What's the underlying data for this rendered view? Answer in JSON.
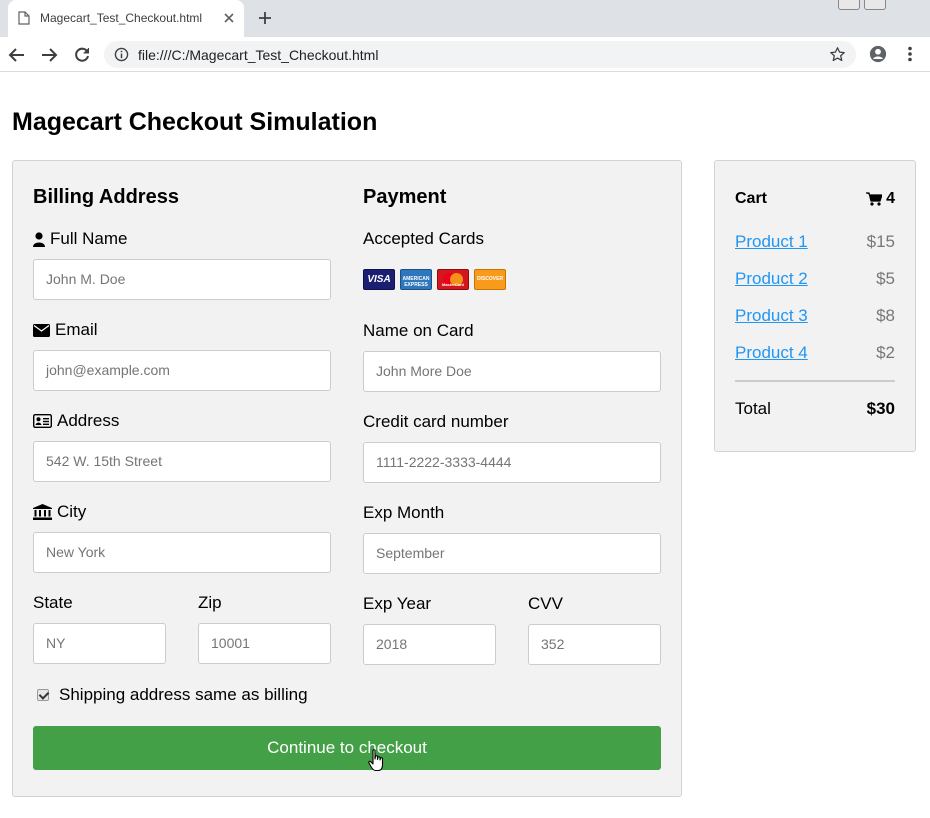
{
  "browser": {
    "tab_title": "Magecart_Test_Checkout.html",
    "url": "file:///C:/Magecart_Test_Checkout.html"
  },
  "page": {
    "title": "Magecart Checkout Simulation"
  },
  "billing": {
    "heading": "Billing Address",
    "full_name": {
      "label": "Full Name",
      "placeholder": "John M. Doe",
      "icon": "user-icon"
    },
    "email": {
      "label": "Email",
      "placeholder": "john@example.com",
      "icon": "envelope-icon"
    },
    "address": {
      "label": "Address",
      "placeholder": "542 W. 15th Street",
      "icon": "address-card-icon"
    },
    "city": {
      "label": "City",
      "placeholder": "New York",
      "icon": "institution-icon"
    },
    "state": {
      "label": "State",
      "placeholder": "NY"
    },
    "zip": {
      "label": "Zip",
      "placeholder": "10001"
    }
  },
  "payment": {
    "heading": "Payment",
    "accepted_cards_label": "Accepted Cards",
    "cards": [
      "VISA",
      "AMERICAN EXPRESS",
      "MasterCard",
      "DISCOVER"
    ],
    "name_on_card": {
      "label": "Name on Card",
      "placeholder": "John More Doe"
    },
    "card_number": {
      "label": "Credit card number",
      "placeholder": "1111-2222-3333-4444"
    },
    "exp_month": {
      "label": "Exp Month",
      "placeholder": "September"
    },
    "exp_year": {
      "label": "Exp Year",
      "placeholder": "2018"
    },
    "cvv": {
      "label": "CVV",
      "placeholder": "352"
    }
  },
  "shipping_same": {
    "label": "Shipping address same as billing",
    "checked": true
  },
  "submit": {
    "label": "Continue to checkout",
    "color": "#43a047"
  },
  "cart": {
    "title": "Cart",
    "count": "4",
    "items": [
      {
        "name": "Product 1",
        "price": "$15"
      },
      {
        "name": "Product 2",
        "price": "$5"
      },
      {
        "name": "Product 3",
        "price": "$8"
      },
      {
        "name": "Product 4",
        "price": "$2"
      }
    ],
    "total_label": "Total",
    "total_value": "$30"
  },
  "colors": {
    "link": "#2196f3",
    "panel": "#f2f2f2"
  }
}
